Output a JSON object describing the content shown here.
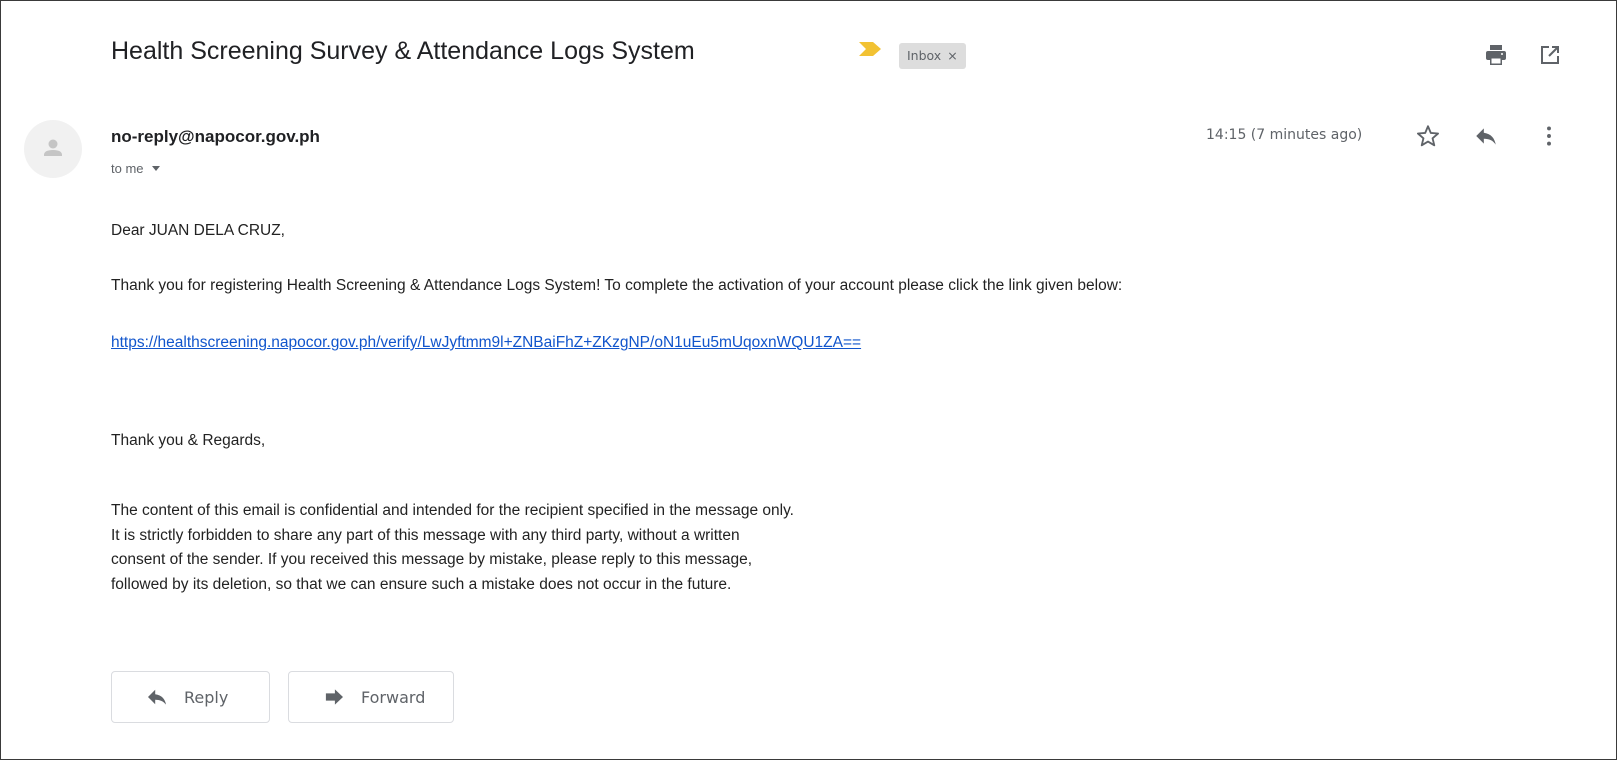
{
  "header": {
    "subject": "Health Screening Survey & Attendance Logs System",
    "label": "Inbox",
    "label_remove": "×",
    "icons": [
      "print-icon",
      "open-in-new-window-icon"
    ],
    "important_marker_color": "#f2c233"
  },
  "message": {
    "sender": "no-reply@napocor.gov.ph",
    "recipient": "to me",
    "timestamp": "14:15 (7 minutes ago)",
    "row_icons": [
      "star-icon",
      "reply-icon",
      "more-vert-icon"
    ]
  },
  "body": {
    "greeting": "Dear JUAN DELA CRUZ,",
    "intro": "Thank you for registering Health Screening & Attendance Logs System! To complete the activation of your account please click the link given below:",
    "link": "https://healthscreening.napocor.gov.ph/verify/LwJyftmm9l+ZNBaiFhZ+ZKzgNP/oN1uEu5mUqoxnWQU1ZA==",
    "closing": "Thank you & Regards,",
    "disclaimer": [
      "The content of this email is confidential and intended for the recipient specified in the message only.",
      "It is strictly forbidden to share any part of this message with any third party, without a written",
      "consent of the sender. If you received this message by mistake, please reply to this message,",
      "followed by its deletion, so that we can ensure such a mistake does not occur in the future."
    ]
  },
  "actions": {
    "reply_label": "Reply",
    "forward_label": "Forward"
  },
  "colors": {
    "link": "#1155cc",
    "icon_gray": "#5f6368",
    "chip_bg": "#dddddd"
  }
}
